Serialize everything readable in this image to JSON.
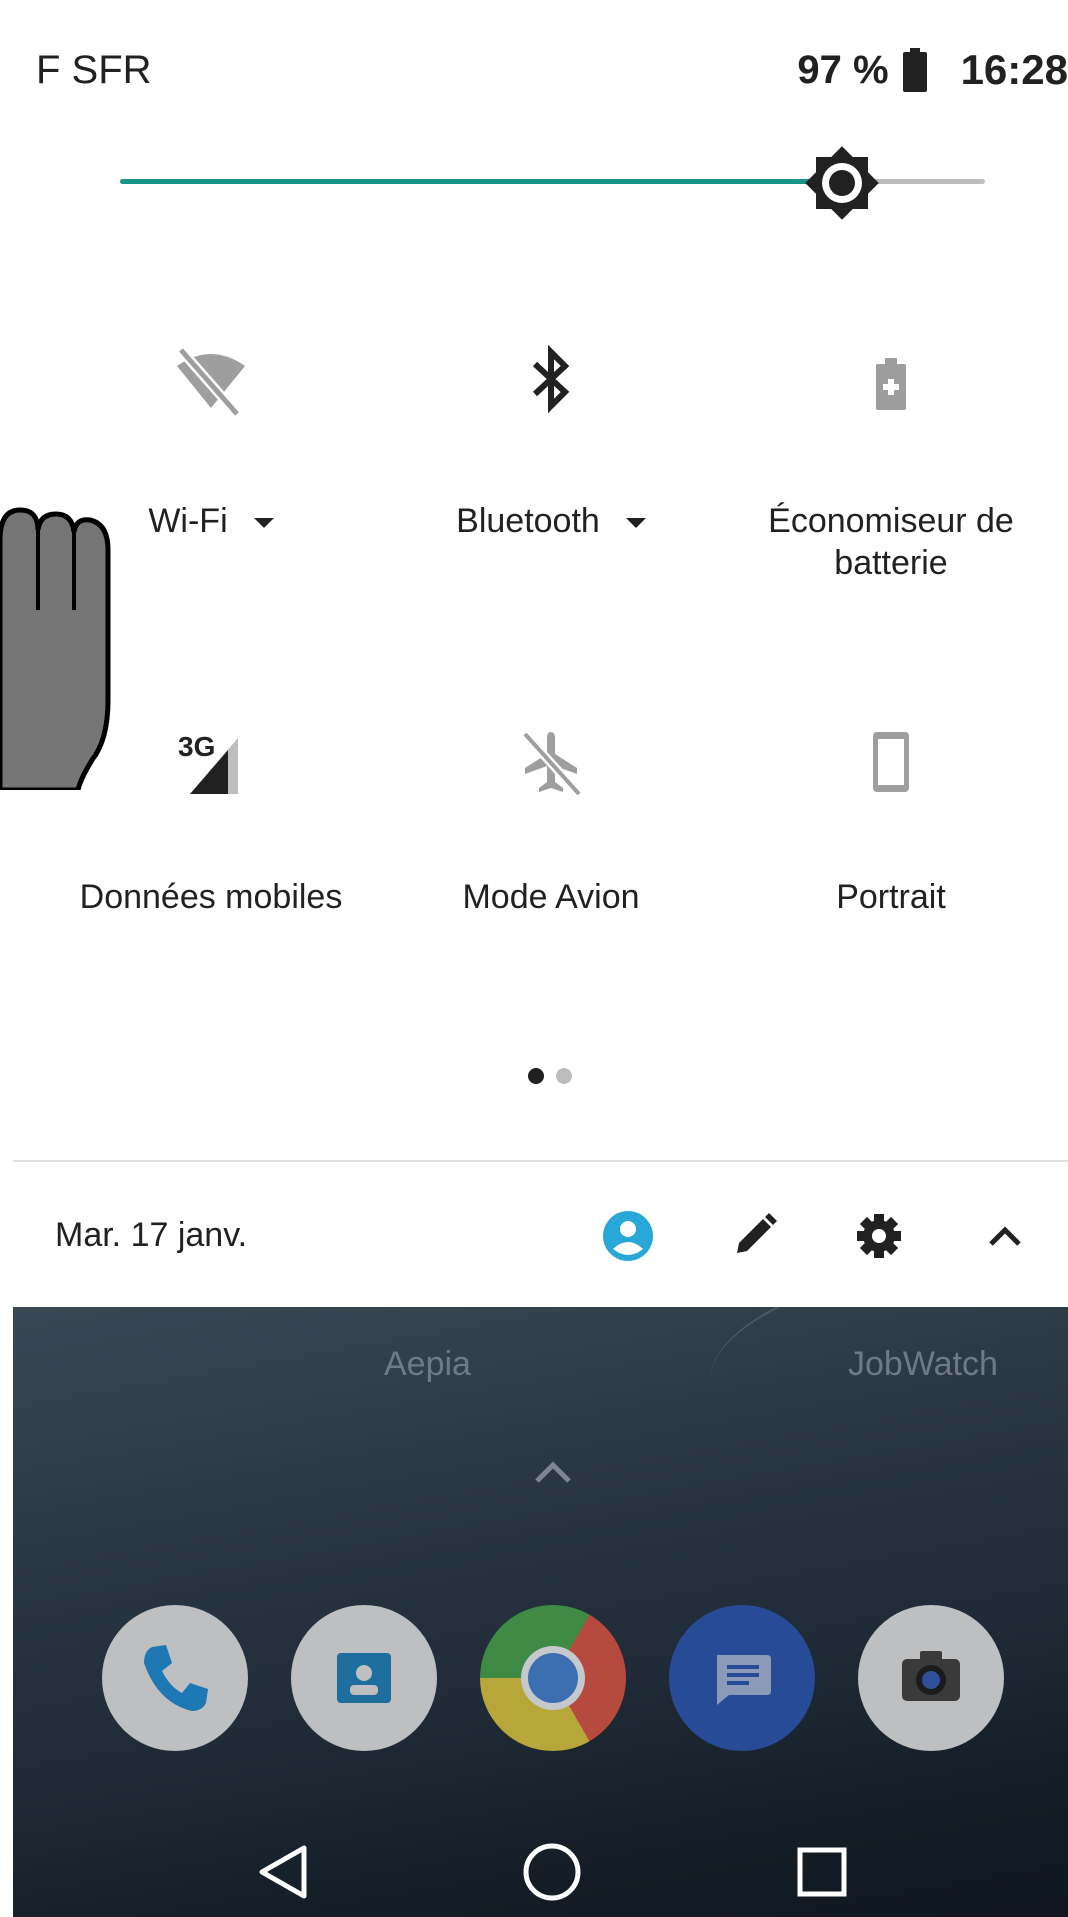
{
  "status_bar": {
    "carrier": "F SFR",
    "battery": "97 %",
    "time": "16:28"
  },
  "brightness": {
    "level": 0.835,
    "fill_color": "#17958a"
  },
  "tiles": [
    {
      "label": "Wi-Fi",
      "icon": "wifi-off-icon",
      "state": "off",
      "has_dropdown": true
    },
    {
      "label": "Bluetooth",
      "icon": "bluetooth-icon",
      "state": "on",
      "has_dropdown": true
    },
    {
      "label_line1": "Économiseur de",
      "label_line2": "batterie",
      "icon": "battery-saver-icon",
      "state": "off"
    },
    {
      "label": "Données mobiles",
      "icon": "mobile-data-3g-icon",
      "badge": "3G",
      "state": "on"
    },
    {
      "label": "Mode Avion",
      "icon": "airplane-mode-off-icon",
      "state": "off"
    },
    {
      "label": "Portrait",
      "icon": "portrait-icon",
      "state": "off"
    }
  ],
  "pager": {
    "pages": 2,
    "current": 1
  },
  "footer": {
    "date": "Mar. 17 janv.",
    "buttons": [
      "user-icon",
      "edit-icon",
      "settings-icon",
      "collapse-icon"
    ],
    "accent": "#29a8d8"
  },
  "home": {
    "folders": [
      "Aepia",
      "JobWatch"
    ],
    "dock": [
      "phone-app-icon",
      "contacts-app-icon",
      "chrome-app-icon",
      "messages-app-icon",
      "camera-app-icon"
    ],
    "nav": [
      "back-icon",
      "home-icon",
      "recents-icon"
    ]
  }
}
